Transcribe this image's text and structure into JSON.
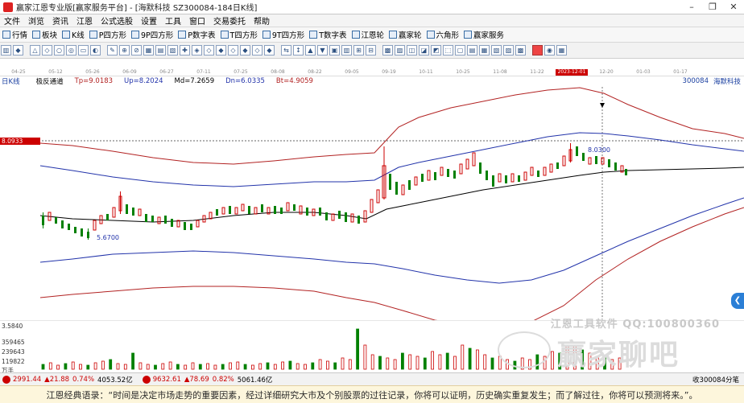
{
  "window": {
    "title": "赢家江恩专业版[赢家服务平台] - [海默科技  SZ300084-184日K线]",
    "buttons": [
      "minimize-icon",
      "restore-icon",
      "close-icon"
    ]
  },
  "menu": [
    "文件",
    "浏览",
    "资讯",
    "江恩",
    "公式选股",
    "设置",
    "工具",
    "窗口",
    "交易委托",
    "帮助"
  ],
  "toolbar": [
    {
      "label": "行情",
      "icon": "quote-icon"
    },
    {
      "label": "板块",
      "icon": "sector-icon"
    },
    {
      "label": "K线",
      "icon": "kline-icon"
    },
    {
      "label": "P四方形",
      "icon": "square-icon"
    },
    {
      "label": "9P四方形",
      "icon": "square9-icon"
    },
    {
      "label": "P数字表",
      "icon": "number-table-icon"
    },
    {
      "label": "T四方形",
      "icon": "t-square-icon"
    },
    {
      "label": "9T四方形",
      "icon": "t-square9-icon"
    },
    {
      "label": "T数字表",
      "icon": "t-number-table-icon"
    },
    {
      "label": "江恩轮",
      "icon": "gann-wheel-icon"
    },
    {
      "label": "赢家轮",
      "icon": "winner-wheel-icon"
    },
    {
      "label": "六角形",
      "icon": "hexagon-icon"
    },
    {
      "label": "赢家服务",
      "icon": "service-icon"
    }
  ],
  "timeline": {
    "dates": [
      "04-25",
      "05-12",
      "05-26",
      "06-09",
      "06-27",
      "07-11",
      "07-25",
      "08-08",
      "08-22",
      "09-05",
      "09-19",
      "10-11",
      "10-25",
      "11-08",
      "11-22",
      "2023-12-01",
      "12-20",
      "01-03",
      "01-17"
    ],
    "highlight": "2023-12-01"
  },
  "indicator": {
    "left_tag": "日K线",
    "name": "极反通道",
    "tp": "Tp=9.0183",
    "up": "Up=8.2024",
    "md": "Md=7.2659",
    "dn": "Dn=6.0335",
    "bt": "Bt=4.9059",
    "stock": "300084",
    "stock_name": "海默科技"
  },
  "price_marker": "8.0933",
  "annotations": {
    "high": "8.0300",
    "low": "5.6700"
  },
  "volume": {
    "labels": [
      "3.5840",
      "359465",
      "239643",
      "119822",
      "万手"
    ]
  },
  "watermark": {
    "line1": "江恩工具软件   QQ:100800360",
    "line2": "赢家聊吧"
  },
  "status": {
    "sh_index": "2991.44",
    "sh_change": "▲21.88",
    "sh_pct": "0.74%",
    "sh_amount": "4053.52亿",
    "sz_index": "9632.61",
    "sz_change": "▲78.69",
    "sz_pct": "0.82%",
    "sz_amount": "5061.46亿",
    "right_info": "收300084分笔"
  },
  "banner": "江恩经典语录：“时间是决定市场走势的重要因素，经过详细研究大市及个别股票的过往记录，你将可以证明，历史确实重复发生；而了解过往，你将可以预测将来。”。",
  "colors": {
    "up": "#cc0000",
    "down": "#008000",
    "mid": "#000000",
    "channel_outer": "#b22222",
    "channel_inner": "#2233aa"
  }
}
